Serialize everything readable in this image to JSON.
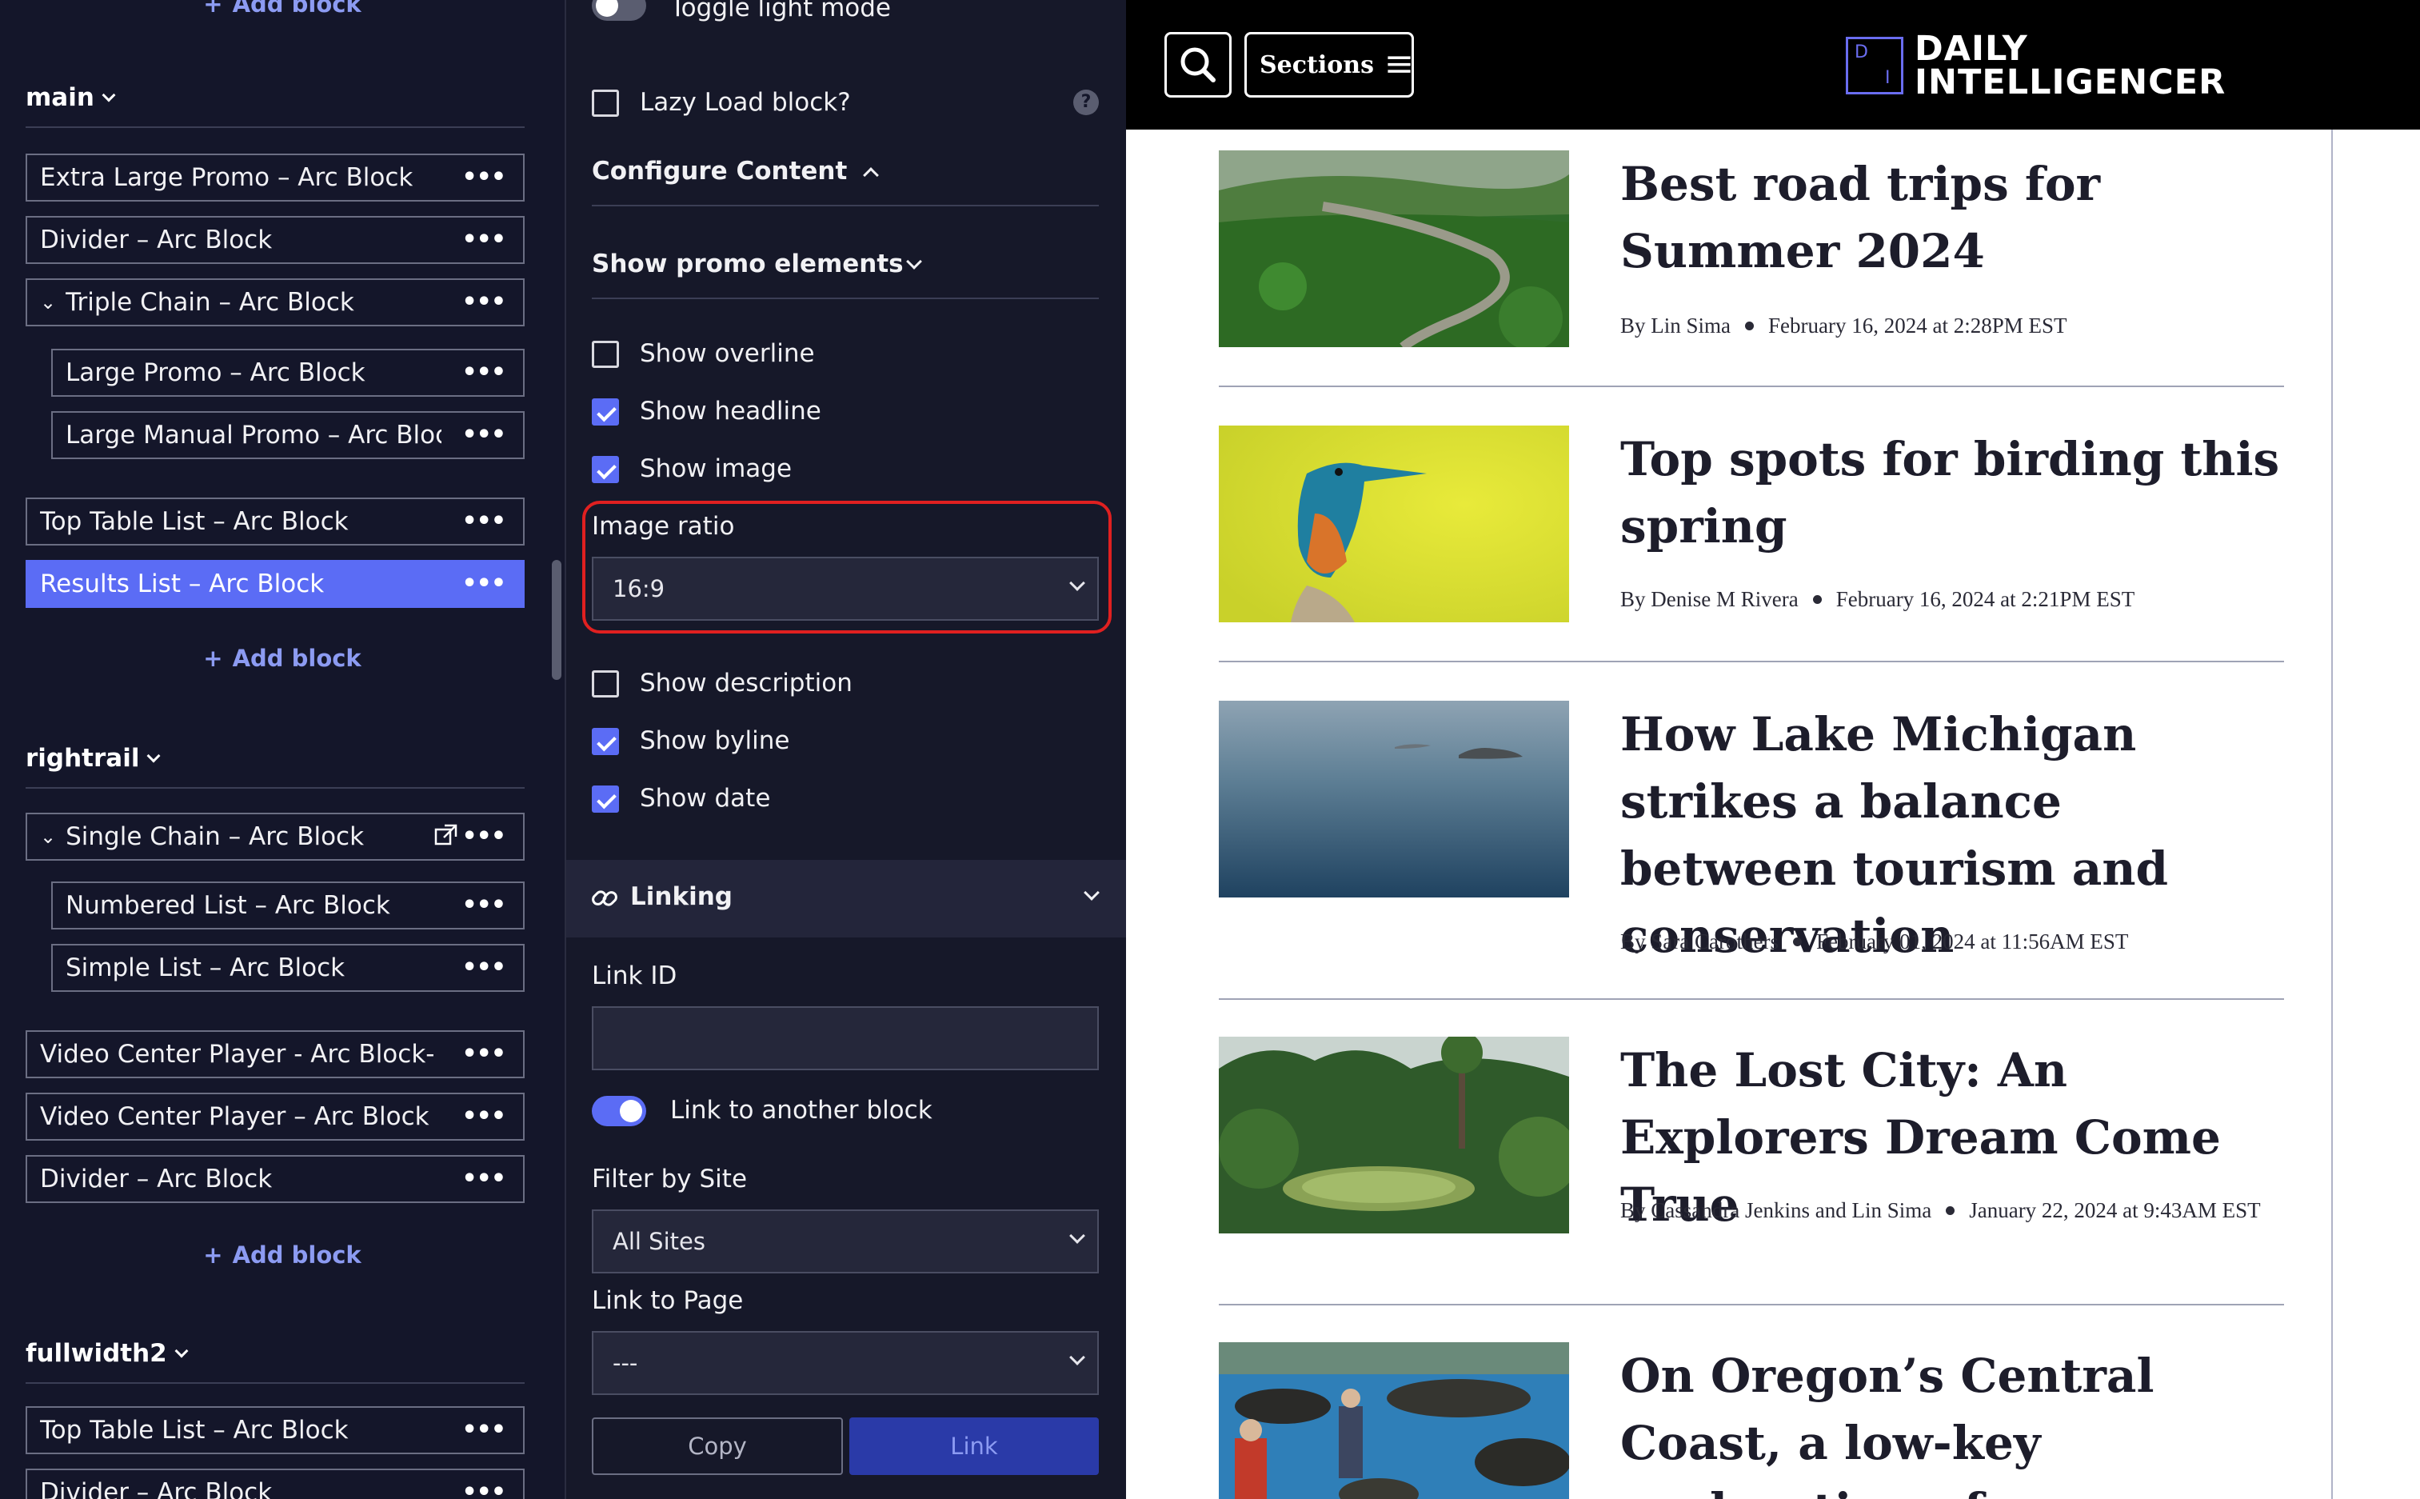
{
  "left": {
    "add_block_label": "Add block",
    "sections": [
      {
        "name": "main",
        "blocks": [
          {
            "label": "Extra Large Promo – Arc Block"
          },
          {
            "label": "Divider – Arc Block"
          },
          {
            "label": "Triple Chain – Arc Block"
          },
          {
            "label": "Large Promo – Arc Block"
          },
          {
            "label": "Large Manual Promo – Arc Bloc"
          },
          {
            "label": "Top Table List – Arc Block"
          },
          {
            "label": "Results List – Arc Block"
          }
        ]
      },
      {
        "name": "rightrail",
        "blocks": [
          {
            "label": "Single Chain – Arc Block"
          },
          {
            "label": "Numbered List – Arc Block"
          },
          {
            "label": "Simple List – Arc Block"
          },
          {
            "label": "Video Center Player - Arc Block-"
          },
          {
            "label": "Video Center Player – Arc Block"
          },
          {
            "label": "Divider – Arc Block"
          }
        ]
      },
      {
        "name": "fullwidth2",
        "blocks": [
          {
            "label": "Top Table List – Arc Block"
          },
          {
            "label": "Divider – Arc Block"
          }
        ]
      }
    ]
  },
  "middle": {
    "toggle_light_mode": "Toggle light mode",
    "lazy_load": "Lazy Load block?",
    "help_glyph": "?",
    "configure_content": "Configure Content",
    "show_promo_elements": "Show promo elements",
    "checkboxes": {
      "overline": {
        "label": "Show overline",
        "checked": false
      },
      "headline": {
        "label": "Show headline",
        "checked": true
      },
      "image": {
        "label": "Show image",
        "checked": true
      },
      "description": {
        "label": "Show description",
        "checked": false
      },
      "byline": {
        "label": "Show byline",
        "checked": true
      },
      "date": {
        "label": "Show date",
        "checked": true
      }
    },
    "image_ratio": {
      "label": "Image ratio",
      "value": "16:9"
    },
    "linking": "Linking",
    "link_id": {
      "label": "Link ID",
      "value": ""
    },
    "link_to_another_block": "Link to another block",
    "filter_by_site": {
      "label": "Filter by Site",
      "value": "All Sites"
    },
    "link_to_page": {
      "label": "Link to Page",
      "value": "---"
    },
    "copy_button": "Copy",
    "link_button": "Link",
    "accent_color": "#5b6cf5",
    "highlight_color": "#e02020"
  },
  "preview": {
    "sections_label": "Sections",
    "logo_line1": "DAILY",
    "logo_line2": "INTELLIGENCER",
    "logo_mark_letters": [
      "D",
      "I"
    ],
    "stories": [
      {
        "headline": "Best road trips for Summer 2024",
        "author": "By Lin Sima",
        "date": "February 16, 2024 at 2:28PM EST"
      },
      {
        "headline": "Top spots for birding this spring",
        "author": "By Denise M Rivera",
        "date": "February 16, 2024 at 2:21PM EST"
      },
      {
        "headline": "How Lake Michigan strikes a balance between tourism and conservation",
        "author": "By Sara Carothers",
        "date": "February 01, 2024 at 11:56AM EST"
      },
      {
        "headline": "The Lost City: An Explorers Dream Come True",
        "author": "By Cassandra Jenkins and Lin Sima",
        "date": "January 22, 2024 at 9:43AM EST"
      },
      {
        "headline": "On Oregon’s Central Coast, a low-key exploration of",
        "author": "",
        "date": ""
      }
    ]
  }
}
